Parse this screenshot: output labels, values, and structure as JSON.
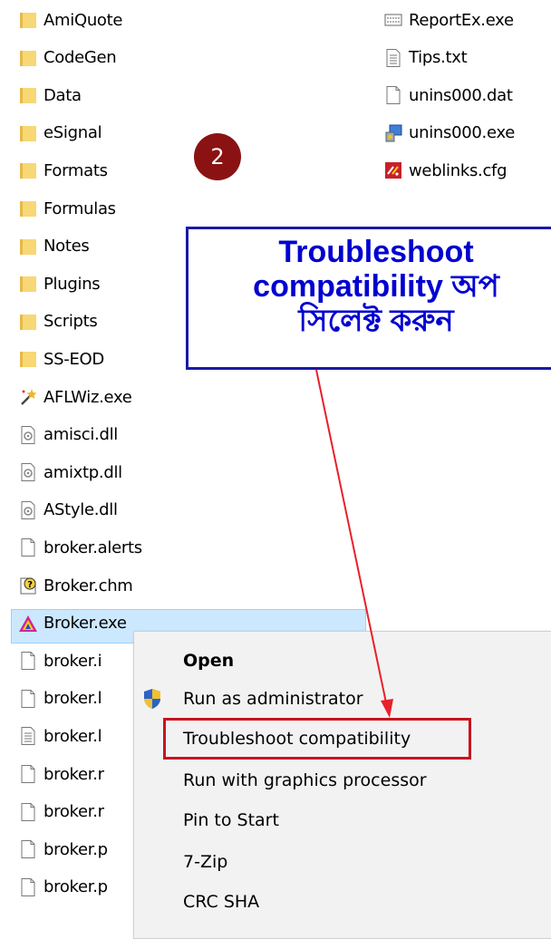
{
  "left_files": [
    {
      "name": "AmiQuote",
      "icon": "folder-icon"
    },
    {
      "name": "CodeGen",
      "icon": "folder-icon"
    },
    {
      "name": "Data",
      "icon": "folder-icon"
    },
    {
      "name": "eSignal",
      "icon": "folder-icon"
    },
    {
      "name": "Formats",
      "icon": "folder-icon"
    },
    {
      "name": "Formulas",
      "icon": "folder-icon"
    },
    {
      "name": "Notes",
      "icon": "folder-icon"
    },
    {
      "name": "Plugins",
      "icon": "folder-icon"
    },
    {
      "name": "Scripts",
      "icon": "folder-icon"
    },
    {
      "name": "SS-EOD",
      "icon": "folder-icon"
    },
    {
      "name": "AFLWiz.exe",
      "icon": "wizard-wand-icon"
    },
    {
      "name": "amisci.dll",
      "icon": "dll-file-icon"
    },
    {
      "name": "amixtp.dll",
      "icon": "dll-file-icon"
    },
    {
      "name": "AStyle.dll",
      "icon": "dll-file-icon"
    },
    {
      "name": "broker.alerts",
      "icon": "blank-file-icon"
    },
    {
      "name": "Broker.chm",
      "icon": "help-file-icon"
    },
    {
      "name": "Broker.exe",
      "icon": "amibroker-app-icon"
    },
    {
      "name": "broker.i",
      "icon": "blank-file-icon"
    },
    {
      "name": "broker.l",
      "icon": "blank-file-icon"
    },
    {
      "name": "broker.l",
      "icon": "text-file-icon"
    },
    {
      "name": "broker.r",
      "icon": "blank-file-icon"
    },
    {
      "name": "broker.r",
      "icon": "blank-file-icon"
    },
    {
      "name": "broker.p",
      "icon": "blank-file-icon"
    },
    {
      "name": "broker.p",
      "icon": "blank-file-icon"
    }
  ],
  "right_files": [
    {
      "name": "ReportEx.exe",
      "icon": "report-app-icon"
    },
    {
      "name": "Tips.txt",
      "icon": "text-file-icon"
    },
    {
      "name": "unins000.dat",
      "icon": "blank-file-icon"
    },
    {
      "name": "unins000.exe",
      "icon": "installer-icon"
    },
    {
      "name": "weblinks.cfg",
      "icon": "config-file-icon"
    }
  ],
  "step_badge": "2",
  "callout": {
    "line1": "Troubleshoot",
    "line2": "compatibility অপ",
    "line3": "সিলেক্ট করুন"
  },
  "context_menu": {
    "open": "Open",
    "run_as_admin": "Run as administrator",
    "troubleshoot": "Troubleshoot compatibility",
    "run_gpu": "Run with graphics processor",
    "pin_start": "Pin to Start",
    "seven_zip": "7-Zip",
    "crc_sha": "CRC SHA"
  },
  "colors": {
    "folder": "#f8d775",
    "selection": "#cce8ff",
    "badge": "#8b1212",
    "callout_text": "#0000d0",
    "highlight": "#c8141e",
    "arrow": "#e8202a"
  }
}
